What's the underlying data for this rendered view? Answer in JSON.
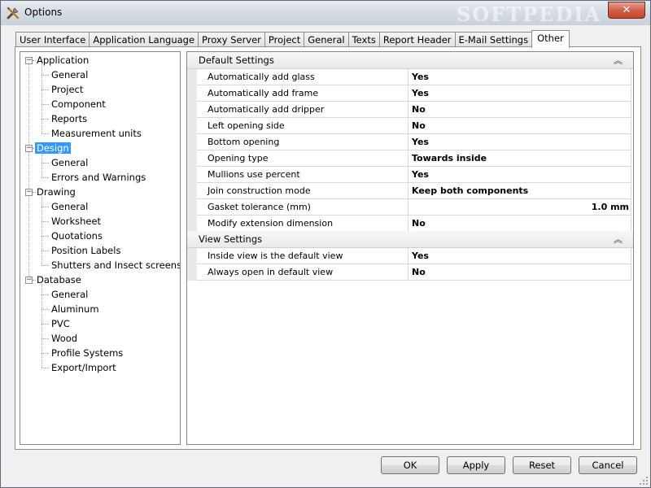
{
  "window": {
    "title": "Options",
    "close_glyph": "✕",
    "watermark": "SOFTPEDIA"
  },
  "tabs": [
    {
      "label": "User Interface"
    },
    {
      "label": "Application Language"
    },
    {
      "label": "Proxy Server"
    },
    {
      "label": "Project"
    },
    {
      "label": "General"
    },
    {
      "label": "Texts"
    },
    {
      "label": "Report Header"
    },
    {
      "label": "E-Mail Settings"
    },
    {
      "label": "Other",
      "active": true
    }
  ],
  "tree": [
    {
      "label": "Application",
      "expanded": true,
      "children": [
        "General",
        "Project",
        "Component",
        "Reports",
        "Measurement units"
      ]
    },
    {
      "label": "Design",
      "expanded": true,
      "selected": true,
      "children": [
        "General",
        "Errors and Warnings"
      ]
    },
    {
      "label": "Drawing",
      "expanded": true,
      "children": [
        "General",
        "Worksheet",
        "Quotations",
        "Position Labels",
        "Shutters and Insect screens"
      ]
    },
    {
      "label": "Database",
      "expanded": true,
      "children": [
        "General",
        "Aluminum",
        "PVC",
        "Wood",
        "Profile Systems",
        "Export/Import"
      ]
    }
  ],
  "property_grid": {
    "categories": [
      {
        "label": "Default Settings",
        "collapse_glyph": "︽",
        "rows": [
          {
            "name": "Automatically add glass",
            "value": "Yes"
          },
          {
            "name": "Automatically add frame",
            "value": "Yes"
          },
          {
            "name": "Automatically add dripper",
            "value": "No"
          },
          {
            "name": "Left opening side",
            "value": "No"
          },
          {
            "name": "Bottom opening",
            "value": "Yes"
          },
          {
            "name": "Opening type",
            "value": "Towards inside"
          },
          {
            "name": "Mullions use percent",
            "value": "Yes"
          },
          {
            "name": "Join construction mode",
            "value": "Keep both components"
          },
          {
            "name": "Gasket tolerance (mm)",
            "value": "1.0 mm",
            "align": "right"
          },
          {
            "name": "Modify extension dimension",
            "value": "No"
          }
        ]
      },
      {
        "label": "View Settings",
        "collapse_glyph": "︽",
        "rows": [
          {
            "name": "Inside view is the default view",
            "value": "Yes"
          },
          {
            "name": "Always open in default view",
            "value": "No"
          }
        ]
      }
    ]
  },
  "buttons": {
    "ok": "OK",
    "apply": "Apply",
    "reset": "Reset",
    "cancel": "Cancel"
  },
  "colors": {
    "selection": "#3399ff",
    "close_button": "#c44329"
  }
}
